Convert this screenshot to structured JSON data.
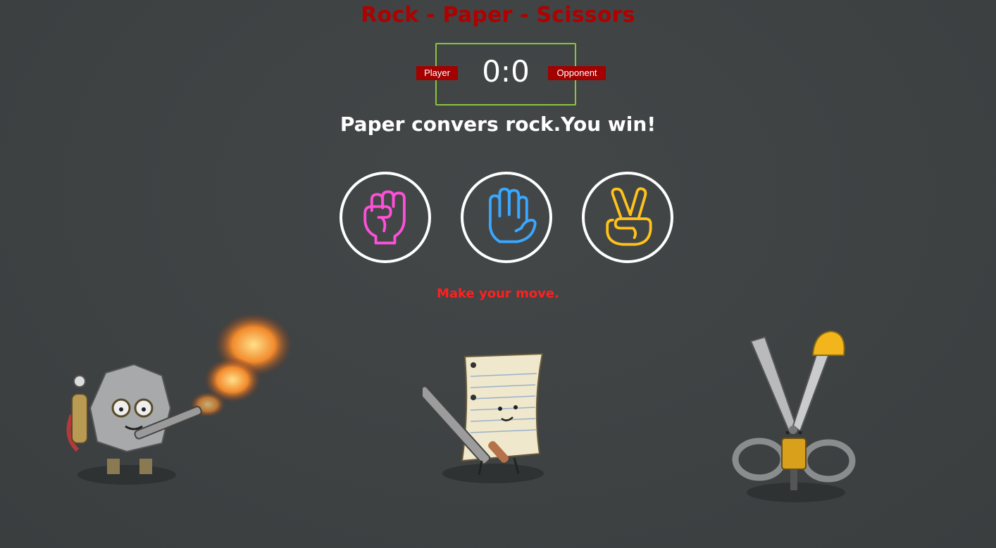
{
  "game": {
    "title": "Rock - Paper - Scissors",
    "score": "0:0",
    "player_label": "Player",
    "opponent_label": "Opponent",
    "result_message": "Paper convers rock.You win!",
    "prompt": "Make your move."
  },
  "choices": [
    {
      "name": "rock",
      "icon": "fist-icon",
      "color": "#ff4fd8"
    },
    {
      "name": "paper",
      "icon": "open-hand-icon",
      "color": "#3aa7ff"
    },
    {
      "name": "scissors",
      "icon": "victory-hand-icon",
      "color": "#ffc21a"
    }
  ],
  "illustrations": [
    {
      "name": "rock-character",
      "icon": "rock-with-flamethrower"
    },
    {
      "name": "paper-character",
      "icon": "paper-with-file"
    },
    {
      "name": "scissors-character",
      "icon": "scissors-with-jackhammer"
    }
  ],
  "colors": {
    "background": "#3e4243",
    "title": "#b00000",
    "scoreboard_border": "#8ac43f",
    "badge": "#a30000",
    "prompt": "#ff2020"
  }
}
